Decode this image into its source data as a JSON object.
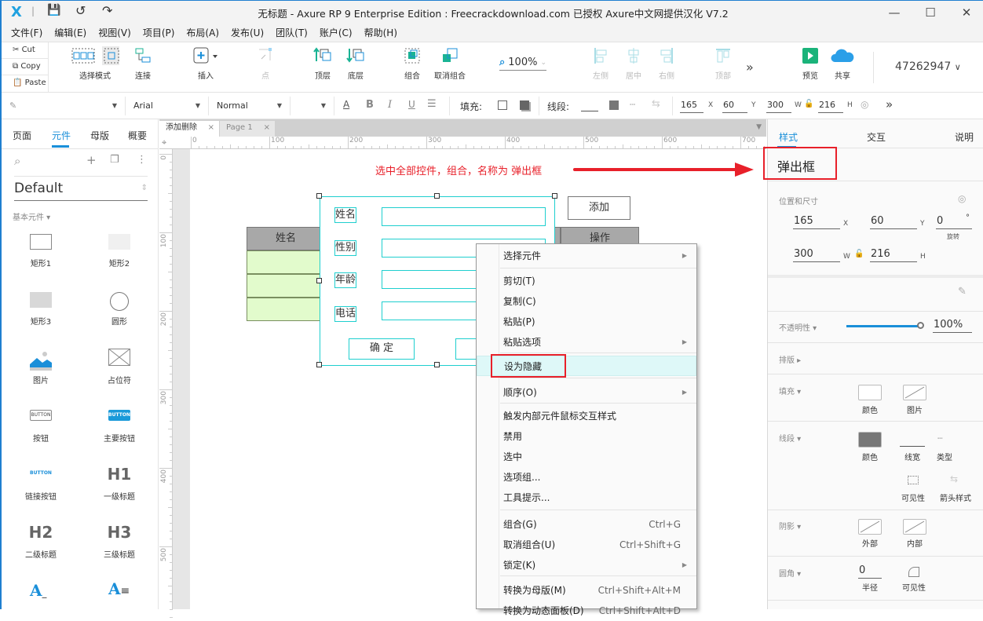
{
  "window": {
    "title": "无标题 - Axure RP 9 Enterprise Edition : Freecrackdownload.com 已授权    Axure中文网提供汉化 V7.2",
    "minimize": "—",
    "maximize": "☐",
    "close": "✕"
  },
  "menubar": [
    "文件(F)",
    "编辑(E)",
    "视图(V)",
    "项目(P)",
    "布局(A)",
    "发布(U)",
    "团队(T)",
    "账户(C)",
    "帮助(H)"
  ],
  "clipboard": {
    "cut": "Cut",
    "copy": "Copy",
    "paste": "Paste"
  },
  "toolbar": {
    "select_mode": "选择模式",
    "connect": "连接",
    "insert": "插入",
    "point": "点",
    "top_layer": "顶层",
    "bottom_layer": "底层",
    "group": "组合",
    "ungroup": "取消组合",
    "zoom": "100%",
    "align_left": "左侧",
    "align_center": "居中",
    "align_right": "右侧",
    "align_top": "顶部",
    "more": "»",
    "preview": "预览",
    "share": "共享",
    "account": "47262947"
  },
  "format": {
    "font": "Arial",
    "weight": "Normal",
    "fill_label": "填充:",
    "line_label": "线段:",
    "x": "165",
    "y": "60",
    "w": "300",
    "h": "216",
    "x_lbl": "X",
    "y_lbl": "Y",
    "w_lbl": "W",
    "h_lbl": "H"
  },
  "leftpanel": {
    "tabs": [
      "页面",
      "元件",
      "母版",
      "概要"
    ],
    "active_tab": "元件",
    "library": "Default",
    "category": "基本元件 ▾",
    "widgets": [
      "矩形1",
      "矩形2",
      "矩形3",
      "圆形",
      "图片",
      "占位符",
      "按钮",
      "主要按钮",
      "链接按钮",
      "一级标题",
      "二级标题",
      "三级标题"
    ],
    "button_text": "BUTTON",
    "h1": "H1",
    "h2": "H2",
    "h3": "H3"
  },
  "doc_tabs": [
    {
      "label": "添加删除",
      "active": true
    },
    {
      "label": "Page 1",
      "active": false
    }
  ],
  "ruler_h": [
    "0",
    "100",
    "200",
    "300",
    "400",
    "500",
    "600",
    "700"
  ],
  "ruler_v": [
    "0",
    "100",
    "200",
    "300",
    "400",
    "500"
  ],
  "canvas": {
    "annotation": "选中全部控件，组合，名称为 弹出框",
    "table_header_name": "姓名",
    "table_header_action": "操作",
    "add_button": "添加",
    "form_labels": [
      "姓名",
      "性别",
      "年龄",
      "电话"
    ],
    "confirm_button": "确 定"
  },
  "context_menu": {
    "items": [
      {
        "label": "选择元件",
        "submenu": true
      },
      {
        "label": "剪切(T)"
      },
      {
        "label": "复制(C)"
      },
      {
        "label": "粘贴(P)"
      },
      {
        "label": "粘贴选项",
        "submenu": true
      },
      {
        "label": "设为隐藏",
        "highlighted": true
      },
      {
        "label": "顺序(O)",
        "submenu": true
      },
      {
        "label": "触发内部元件鼠标交互样式"
      },
      {
        "label": "禁用"
      },
      {
        "label": "选中"
      },
      {
        "label": "选项组..."
      },
      {
        "label": "工具提示..."
      },
      {
        "label": "组合(G)",
        "shortcut": "Ctrl+G"
      },
      {
        "label": "取消组合(U)",
        "shortcut": "Ctrl+Shift+G"
      },
      {
        "label": "锁定(K)",
        "submenu": true
      },
      {
        "label": "转换为母版(M)",
        "shortcut": "Ctrl+Shift+Alt+M"
      },
      {
        "label": "转换为动态面板(D)",
        "shortcut": "Ctrl+Shift+Alt+D"
      }
    ]
  },
  "rightpanel": {
    "tabs": [
      "样式",
      "交互",
      "说明"
    ],
    "active_tab": "样式",
    "widget_name": "弹出框",
    "pos_size_label": "位置和尺寸",
    "x": "165",
    "y": "60",
    "rotation": "0",
    "rotation_label": "旋转",
    "w": "300",
    "h": "216",
    "opacity_label": "不透明性 ▾",
    "opacity": "100%",
    "opacity_value": 1.0,
    "layout_label": "排版 ▸",
    "fill_label": "填充 ▾",
    "fill_color": "颜色",
    "fill_image": "图片",
    "line_label": "线段 ▾",
    "line_color": "颜色",
    "line_width": "线宽",
    "line_type": "类型",
    "line_visibility": "可见性",
    "arrow_style": "箭头样式",
    "shadow_label": "阴影 ▾",
    "shadow_outer": "外部",
    "shadow_inner": "内部",
    "radius_label": "圆角 ▾",
    "radius": "0",
    "radius_caption": "半径",
    "radius_visibility": "可见性"
  },
  "colors": {
    "accent": "#1a8fd9",
    "selection": "#1fcfcf",
    "annotation": "#e8202a",
    "table_header": "#a8a8a8",
    "table_row": "#e2fbcc"
  }
}
